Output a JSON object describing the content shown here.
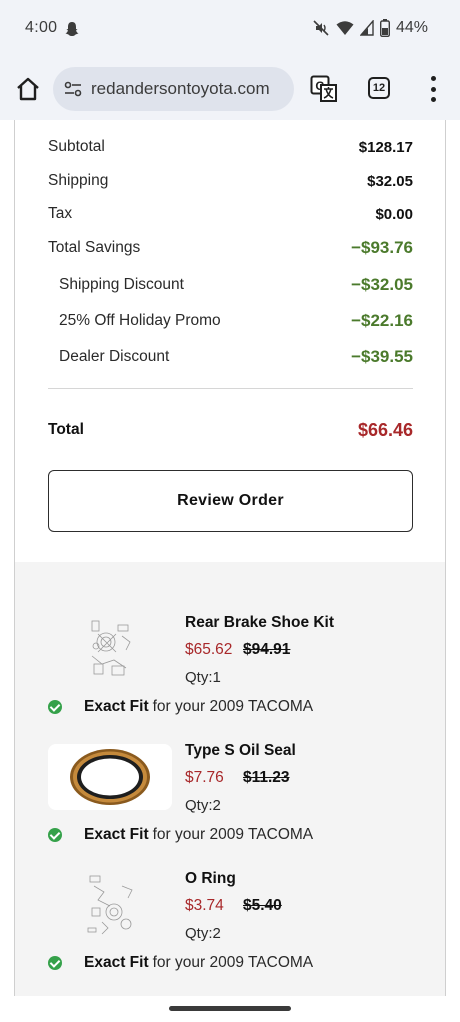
{
  "status_bar": {
    "time": "4:00",
    "battery_percent": "44%",
    "icons": [
      "snapchat-ghost-icon",
      "mute-icon",
      "wifi-icon",
      "signal-icon",
      "battery-icon"
    ]
  },
  "browser": {
    "url": "redandersontoyota.com",
    "tab_count": "12",
    "icons": [
      "home-icon",
      "site-settings-icon",
      "translate-icon",
      "tabs-icon",
      "more-menu-icon"
    ]
  },
  "summary": {
    "subtotal": {
      "label": "Subtotal",
      "value": "$128.17"
    },
    "shipping": {
      "label": "Shipping",
      "value": "$32.05"
    },
    "tax": {
      "label": "Tax",
      "value": "$0.00"
    },
    "total_savings": {
      "label": "Total Savings",
      "value": "−$93.76"
    },
    "shipping_discount": {
      "label": "Shipping Discount",
      "value": "−$32.05"
    },
    "holiday_promo": {
      "label": "25% Off Holiday Promo",
      "value": "−$22.16"
    },
    "dealer_discount": {
      "label": "Dealer Discount",
      "value": "−$39.55"
    },
    "total": {
      "label": "Total",
      "value": "$66.46"
    }
  },
  "review_button": "Review Order",
  "items": [
    {
      "name": "Rear Brake Shoe Kit",
      "price": "$65.62",
      "original_price": "$94.91",
      "qty": "Qty:1",
      "fit_bold": "Exact Fit",
      "fit_text": "for your 2009 TACOMA"
    },
    {
      "name": "Type S Oil Seal",
      "price": "$7.76",
      "original_price": "$11.23",
      "qty": "Qty:2",
      "fit_bold": "Exact Fit",
      "fit_text": "for your 2009 TACOMA"
    },
    {
      "name": "O Ring",
      "price": "$3.74",
      "original_price": "$5.40",
      "qty": "Qty:2",
      "fit_bold": "Exact Fit",
      "fit_text": "for your 2009 TACOMA"
    }
  ],
  "colors": {
    "savings_green": "#4b7a2c",
    "price_red": "#a8282a",
    "fit_check_green": "#35a14a",
    "browser_chrome": "#f1f3f8"
  }
}
